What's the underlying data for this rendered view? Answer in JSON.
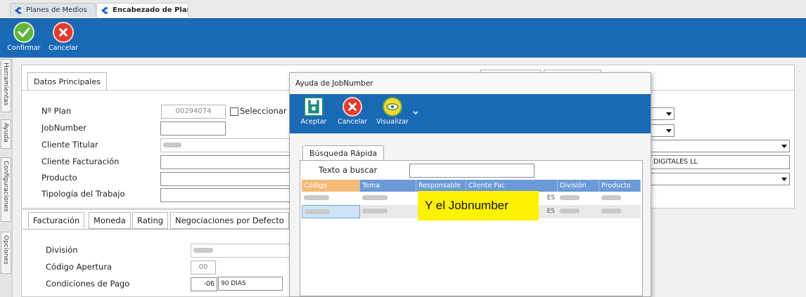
{
  "tabs": [
    {
      "label": "Planes de Medios"
    },
    {
      "label": "Encabezado de Plan"
    }
  ],
  "toolbar": {
    "confirm_label": "Confirmar",
    "cancel_label": "Cancelar"
  },
  "side_tabs": [
    "Herramientas",
    "Ayuda",
    "Configuraciones",
    "Opciones"
  ],
  "form": {
    "section_tab": "Datos Principales",
    "labels": {
      "plan_number": "Nº Plan",
      "jobnumber": "JobNumber",
      "cliente_titular": "Cliente Titular",
      "cliente_facturacion": "Cliente Facturación",
      "producto": "Producto",
      "tipologia": "Tipología del Trabajo"
    },
    "plan_number_value": "00294074",
    "select_checkbox_label": "Seleccionar",
    "right_field_text": "DIGITALES LL"
  },
  "subtabs": [
    "Facturación",
    "Moneda",
    "Rating",
    "Negociaciones por Defecto"
  ],
  "billing": {
    "labels": {
      "division": "División",
      "codigo_apertura": "Código Apertura",
      "condiciones_pago": "Condiciones de Pago"
    },
    "codigo_apertura_value": "00",
    "condiciones_code": "-06",
    "condiciones_desc": "90 DIAS"
  },
  "dialog": {
    "title": "Ayuda de JobNumber",
    "buttons": {
      "accept": "Aceptar",
      "cancel": "Cancelar",
      "view": "Visualizar"
    },
    "quick_tab": "Búsqueda Rápida",
    "search_label": "Texto a buscar",
    "grid_headers": [
      "Código",
      "Tema",
      "Responsable",
      "Cliente Fac",
      "División",
      "Producto"
    ],
    "row_fragments": [
      "ES",
      "ES"
    ]
  },
  "annotation": "Y el Jobnumber",
  "colors": {
    "toolbar_blue": "#1a69b5",
    "grid_header": "#6b9ad8",
    "sorted_header": "#f5b978",
    "annotation_bg": "#fff200"
  }
}
